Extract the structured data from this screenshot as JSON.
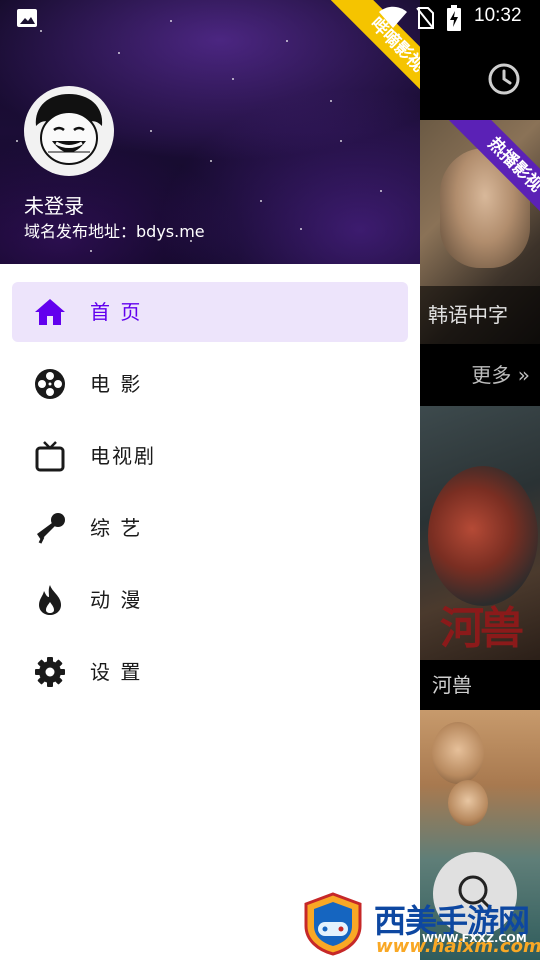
{
  "status_bar": {
    "time": "10:32",
    "icons": [
      "gallery-icon",
      "wifi-icon",
      "no-sim-icon",
      "battery-charging-icon"
    ]
  },
  "drawer": {
    "ribbon": "哔嘀影视",
    "user": {
      "login_status": "未登录",
      "domain_info": "域名发布地址：bdys.me"
    },
    "accent_color": "#6200ee",
    "active_background": "#ede4fb",
    "items": [
      {
        "label": "首 页",
        "icon": "home-icon",
        "active": true
      },
      {
        "label": "电 影",
        "icon": "film-reel-icon",
        "active": false
      },
      {
        "label": "电视剧",
        "icon": "tv-icon",
        "active": false
      },
      {
        "label": "综 艺",
        "icon": "microphone-icon",
        "active": false
      },
      {
        "label": "动 漫",
        "icon": "fire-icon",
        "active": false
      },
      {
        "label": "设 置",
        "icon": "gear-icon",
        "active": false
      }
    ]
  },
  "background_app": {
    "history_icon": "history-icon",
    "card1": {
      "ribbon": "热播影视",
      "ribbon_color": "#5b21b6",
      "caption": "韩语中字"
    },
    "more_label": "更多 »",
    "card2": {
      "poster_text": "河兽",
      "caption": "河兽"
    },
    "fab_icon": "search-icon"
  },
  "watermark": {
    "text": "西美手游网",
    "url_small": "WWW.FXXZ.COM",
    "url": "www.haixm.com"
  }
}
